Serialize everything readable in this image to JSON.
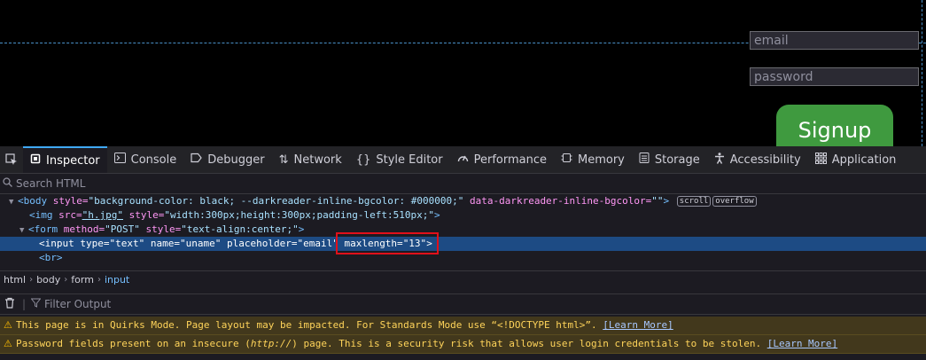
{
  "page": {
    "email_placeholder": "email",
    "password_placeholder": "password",
    "signup_label": "Signup"
  },
  "toolbar": {
    "tabs": [
      {
        "label": "Inspector",
        "icon": "inspector-icon"
      },
      {
        "label": "Console",
        "icon": "console-icon"
      },
      {
        "label": "Debugger",
        "icon": "debugger-icon"
      },
      {
        "label": "Network",
        "icon": "network-icon"
      },
      {
        "label": "Style Editor",
        "icon": "style-editor-icon"
      },
      {
        "label": "Performance",
        "icon": "performance-icon"
      },
      {
        "label": "Memory",
        "icon": "memory-icon"
      },
      {
        "label": "Storage",
        "icon": "storage-icon"
      },
      {
        "label": "Accessibility",
        "icon": "accessibility-icon"
      },
      {
        "label": "Application",
        "icon": "application-icon"
      }
    ]
  },
  "search": {
    "placeholder": "Search HTML"
  },
  "markup": {
    "body_open": "<body",
    "body_style": "style=",
    "body_style_val": "\"background-color: black; --darkreader-inline-bgcolor: #000000;\"",
    "body_data": "data-darkreader-inline-bgcolor=",
    "body_data_val": "\"\"",
    "body_close": ">",
    "badge_scroll": "scroll",
    "badge_overflow": "overflow",
    "img_open": "<img",
    "img_src": "src=",
    "img_src_val": "\"h.jpg\"",
    "img_style": "style=",
    "img_style_val": "\"width:300px;height:300px;padding-left:510px;\"",
    "img_close": ">",
    "form_open": "<form",
    "form_method": "method=",
    "form_method_val": "\"POST\"",
    "form_style": "style=",
    "form_style_val": "\"text-align:center;\"",
    "form_close": ">",
    "input_open": "<input",
    "input_type": "type=",
    "input_type_val": "\"text\"",
    "input_name": "name=",
    "input_name_val": "\"uname\"",
    "input_ph": "placeholder=",
    "input_ph_val": "\"email\"",
    "input_max": "maxlength=",
    "input_max_val": "\"13\"",
    "input_close": ">",
    "br": "<br>"
  },
  "breadcrumbs": [
    "html",
    "body",
    "form",
    "input"
  ],
  "console": {
    "filter_placeholder": "Filter Output",
    "messages": [
      {
        "text": "This page is in Quirks Mode. Page layout may be impacted. For Standards Mode use “<!DOCTYPE html>”.",
        "link": "[Learn More]"
      },
      {
        "text_pre": "Password fields present on an insecure (",
        "text_em": "http://",
        "text_post": ") page. This is a security risk that allows user login credentials to be stolen.",
        "link": "[Learn More]"
      }
    ]
  }
}
